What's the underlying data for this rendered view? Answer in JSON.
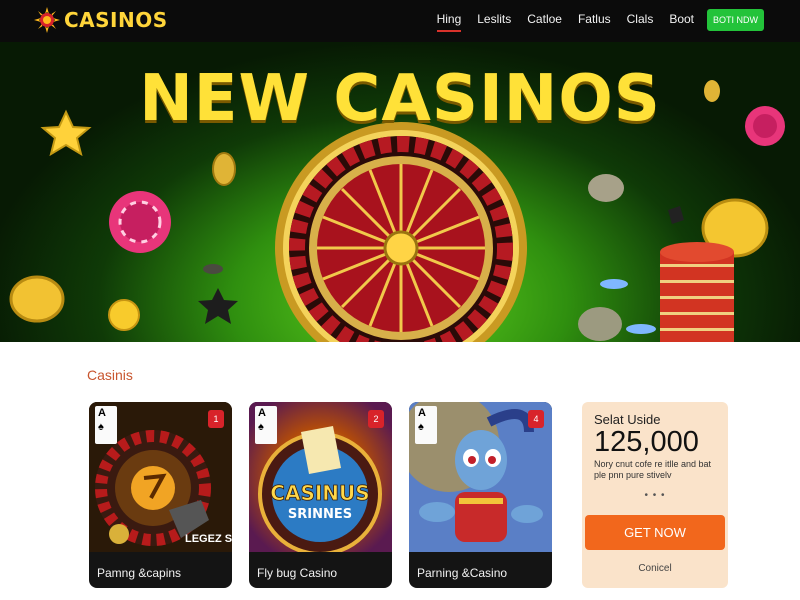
{
  "brand": {
    "name": "CASINOS"
  },
  "nav": {
    "links": [
      {
        "label": "Hing",
        "active": true
      },
      {
        "label": "Leslits",
        "active": false
      },
      {
        "label": "Catloe",
        "active": false
      },
      {
        "label": "Fatlus",
        "active": false
      },
      {
        "label": "Clals",
        "active": false
      },
      {
        "label": "Boot",
        "active": false
      }
    ],
    "cta_label": "BOTI NDW"
  },
  "hero": {
    "title": "NEW CASINOS"
  },
  "section": {
    "label": "Casinis"
  },
  "cards": [
    {
      "caption": "Pamng &capins",
      "ace_rank": "A",
      "ace_suit": "♠",
      "badge": "1",
      "art_text": "LEGEZ STYLE"
    },
    {
      "caption": "Fly bug Casino",
      "ace_rank": "A",
      "ace_suit": "♠",
      "badge": "2",
      "art_text_1": "CASINUS",
      "art_text_2": "SRINNES"
    },
    {
      "caption": "Parning &Casino",
      "ace_rank": "A",
      "ace_suit": "♠",
      "badge": "4"
    }
  ],
  "promo": {
    "title": "Selat Uside",
    "value": "125,000",
    "description": "Nory cnut cofe re itlle and bat ple pnn pure stivelv",
    "dots": "• • •",
    "button_label": "GET NOW",
    "cancel_label": "Conicel"
  },
  "colors": {
    "accent_green": "#23c33a",
    "brand_yellow": "#ffe138",
    "cta_orange": "#f2671c",
    "badge_red": "#d8232a"
  }
}
